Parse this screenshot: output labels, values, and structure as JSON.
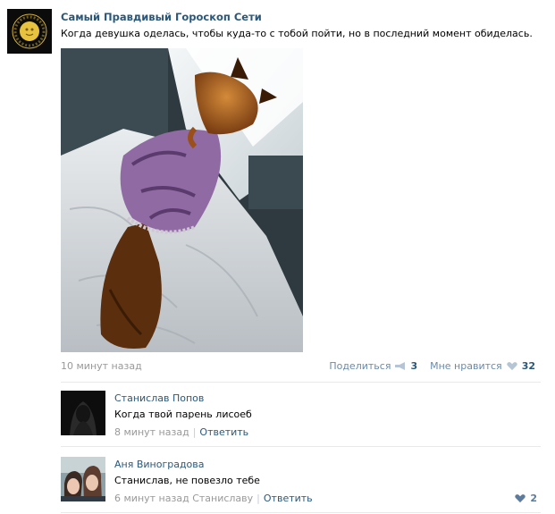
{
  "post": {
    "author": "Самый Правдивый Гороскоп Сети",
    "text": "Когда девушка оделась, чтобы куда-то с тобой пойти, но в последний момент обиделась.",
    "time": "10 минут назад",
    "share_label": "Поделиться",
    "share_count": "3",
    "like_label": "Мне нравится",
    "like_count": "32"
  },
  "comments": [
    {
      "author": "Станислав Попов",
      "text": "Когда твой парень лисоеб",
      "time": "8 минут назад",
      "reply_label": "Ответить"
    },
    {
      "author": "Аня Виноградова",
      "text": "Станислав, не повезло тебе",
      "time": "6 минут назад",
      "reply_to": "Станиславу",
      "reply_label": "Ответить",
      "likes": "2"
    }
  ],
  "colors": {
    "link": "#2b587a",
    "muted": "#999999",
    "action": "#6a8aaa"
  },
  "icons": {
    "share": "megaphone-icon",
    "like": "heart-icon"
  }
}
